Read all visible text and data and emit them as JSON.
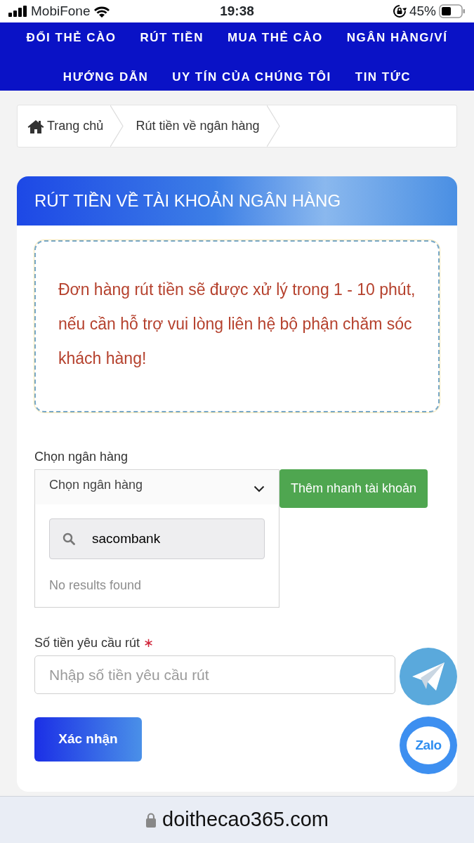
{
  "status_bar": {
    "carrier": "MobiFone",
    "time": "19:38",
    "battery": "45%"
  },
  "nav": {
    "items": [
      {
        "label": "ĐỔI THẺ CÀO"
      },
      {
        "label": "RÚT TIỀN"
      },
      {
        "label": "MUA THẺ CÀO"
      },
      {
        "label": "NGÂN HÀNG/VÍ"
      },
      {
        "label": "HƯỚNG DẪN"
      },
      {
        "label": "UY TÍN CỦA CHÚNG TÔI"
      },
      {
        "label": "TIN TỨC"
      }
    ]
  },
  "breadcrumb": [
    {
      "label": "Trang chủ",
      "kind": "home"
    },
    {
      "label": "Rút tiền về ngân hàng",
      "kind": "page"
    }
  ],
  "card": {
    "title": "RÚT TIỀN VỀ TÀI KHOẢN NGÂN HÀNG",
    "notice": "Đơn hàng rút tiền sẽ được xử lý trong 1 - 10 phút, nếu cần hỗ trợ vui lòng liên hệ bộ phận chăm sóc khách hàng!",
    "bank_field": {
      "label": "Chọn ngân hàng",
      "value": "Chọn ngân hàng",
      "expanded": true
    },
    "add_button": "Thêm nhanh tài khoản",
    "dropdown": {
      "search_value": "sacombank",
      "message": "No results found"
    },
    "amount_field": {
      "label": "Số tiền yêu cầu rút",
      "required_mark": "∗",
      "placeholder": "Nhập số tiền yêu cầu rút"
    },
    "submit": "Xác nhận"
  },
  "floating": [
    {
      "kind": "telegram"
    },
    {
      "kind": "zalo",
      "label": "Zalo"
    }
  ],
  "address_bar": {
    "url": "doithecao365.com"
  }
}
